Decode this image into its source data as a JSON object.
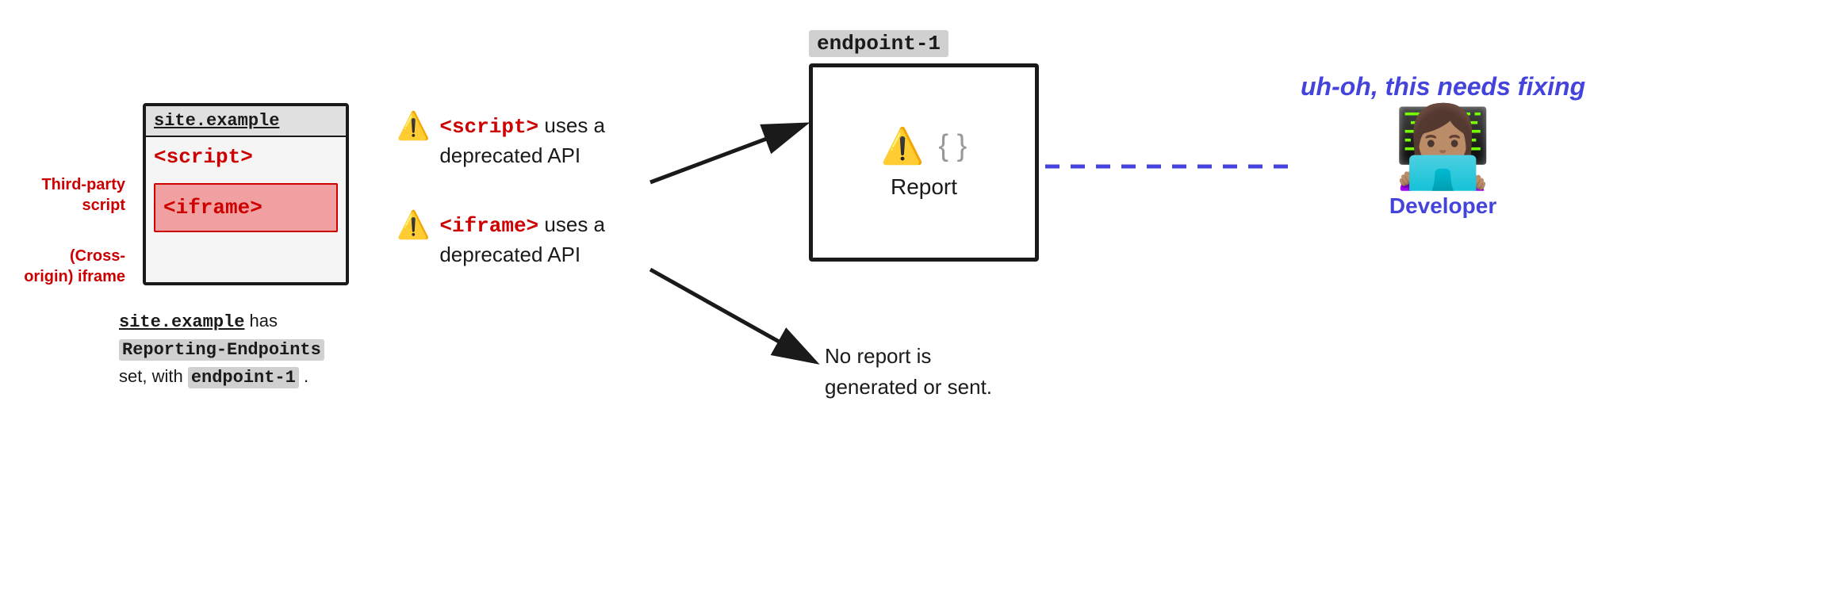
{
  "site_box": {
    "title": "site.example",
    "script_label": "<script>",
    "iframe_label": "<iframe>"
  },
  "labels": {
    "third_party": "Third-party script",
    "cross_origin": "(Cross-origin) iframe"
  },
  "bottom_text": {
    "line1_mono": "site.example",
    "line1_rest": " has",
    "line2_highlight": "Reporting-Endpoints",
    "line3_rest": "set, with",
    "line3_highlight": "endpoint-1",
    "line3_end": "."
  },
  "warnings": [
    {
      "icon": "⚠️",
      "text_red": "<script>",
      "text_rest": " uses a deprecated API"
    },
    {
      "icon": "⚠️",
      "text_red": "<iframe>",
      "text_rest": " uses a deprecated API"
    }
  ],
  "endpoint": {
    "label": "endpoint-1",
    "report_text": "Report"
  },
  "no_report": {
    "text": "No report is generated or sent."
  },
  "developer": {
    "uh_oh": "uh-oh, this needs fixing",
    "emoji": "👩🏽‍💻",
    "label": "Developer"
  },
  "arrows": {
    "script_to_endpoint": "arrow from warnings to endpoint",
    "iframe_to_noreport": "arrow from iframe warning to no report"
  },
  "colors": {
    "red": "#cc0000",
    "blue": "#4444dd",
    "dark": "#1a1a1a",
    "gray_bg": "#d0d0d0"
  }
}
